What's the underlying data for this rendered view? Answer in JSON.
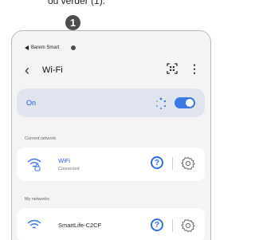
{
  "caption": "ou verder (1).",
  "callout": {
    "number": "1"
  },
  "status_bar": {
    "app_name": "Barem Smart"
  },
  "header": {
    "back_symbol": "‹",
    "title": "Wi-Fi",
    "more_symbol": "⋮"
  },
  "toggle_card": {
    "label": "On",
    "enabled": true
  },
  "sections": {
    "current_label": "Current network",
    "my_label": "My networks"
  },
  "current_network": {
    "name": "WiFi",
    "status": "Connected"
  },
  "my_networks": [
    {
      "name": "SmartLife-C2CF"
    }
  ],
  "colors": {
    "accent": "#2f6fe0",
    "card_bg": "#dfe4ee",
    "screen_bg": "#f4f4f4"
  }
}
